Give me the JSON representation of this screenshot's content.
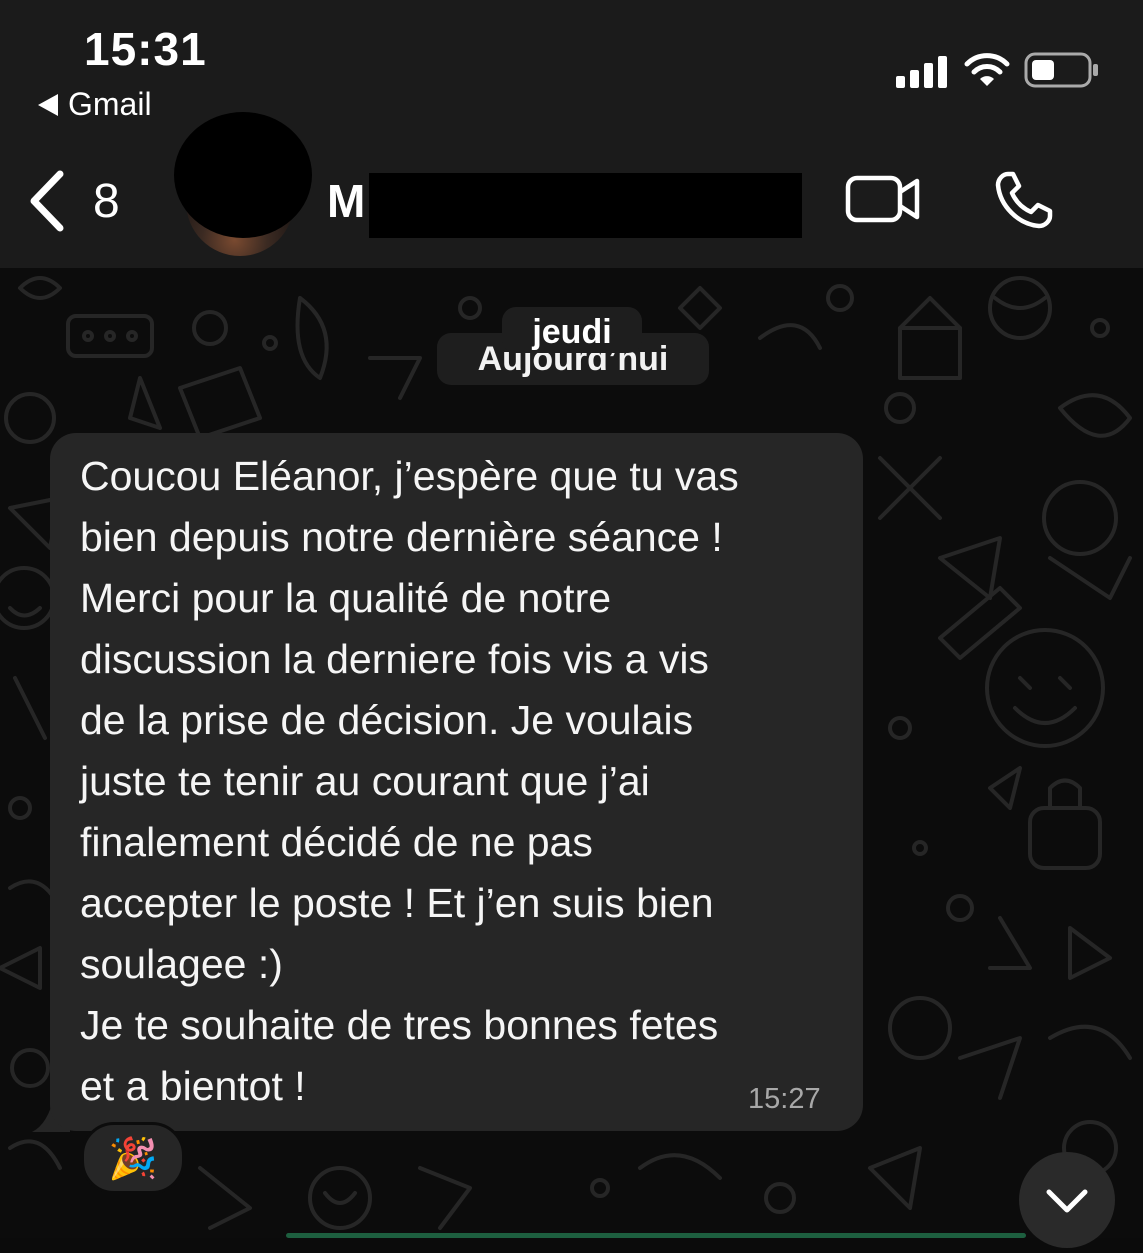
{
  "status_bar": {
    "time": "15:31",
    "back_app_label": "Gmail",
    "icons": [
      "cellular-signal-icon",
      "wifi-icon",
      "battery-icon"
    ]
  },
  "header": {
    "back_icon": "chevron-left-icon",
    "unread_count": "8",
    "contact_initial": "M",
    "actions": [
      "video-call-icon",
      "phone-call-icon"
    ]
  },
  "chat": {
    "date_separator_behind": "Aujourd’hui",
    "date_separator_front": "jeudi",
    "message": {
      "text": "Coucou Eléanor, j’espère que tu vas\nbien depuis notre dernière séance !\nMerci pour la qualité de notre\ndiscussion la derniere fois vis a vis\nde la prise de décision. Je voulais\njuste te tenir au courant que j’ai\nfinalement décidé de ne pas\naccepter le poste ! Et j’en suis bien\nsoulagee :)\nJe te souhaite de tres bonnes fetes\net a bientot !",
      "time": "15:27",
      "reaction": "🎉"
    },
    "scroll_down_icon": "chevron-down-icon"
  },
  "colors": {
    "header_bg": "#1b1b1b",
    "chat_bg": "#0c0c0c",
    "bubble_bg": "#262626",
    "accent": "#1d5f3f"
  }
}
